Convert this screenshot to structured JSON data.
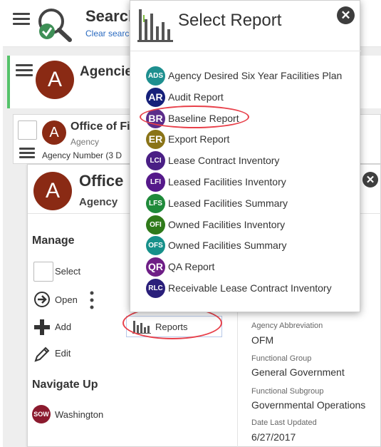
{
  "search": {
    "title": "Search",
    "subtitle": "Clear search"
  },
  "agencies": {
    "title": "Agencies",
    "avatar_letter": "A"
  },
  "office_row": {
    "avatar_letter": "A",
    "title": "Office of Fi",
    "subtitle": "Agency",
    "agency_number_label": "Agency Number (3 D"
  },
  "detail": {
    "avatar_letter": "A",
    "title": "Office",
    "subtitle": "Agency",
    "manage_heading": "Manage",
    "actions": {
      "select": "Select",
      "open": "Open",
      "add": "Add",
      "edit": "Edit"
    },
    "reports_button": "Reports",
    "navigate_heading": "Navigate Up",
    "navigate_item": {
      "badge": "SOW",
      "label": "Washington"
    },
    "fields": [
      {
        "label": "Agency Abbreviation",
        "value": "OFM"
      },
      {
        "label": "Functional Group",
        "value": "General Government"
      },
      {
        "label": "Functional Subgroup",
        "value": "Governmental Operations"
      },
      {
        "label": "Date Last Updated",
        "value": "6/27/2017"
      }
    ]
  },
  "popup": {
    "title": "Select Report",
    "reports": [
      {
        "abbr": "ADS",
        "label": "Agency Desired Six Year Facilities Plan",
        "color": "#1e8f8f"
      },
      {
        "abbr": "AR",
        "label": "Audit Report",
        "color": "#16207a"
      },
      {
        "abbr": "BR",
        "label": "Baseline Report",
        "color": "#5b2d8a"
      },
      {
        "abbr": "ER",
        "label": "Export Report",
        "color": "#8a7418"
      },
      {
        "abbr": "LCI",
        "label": "Lease Contract Inventory",
        "color": "#4a1f85"
      },
      {
        "abbr": "LFI",
        "label": "Leased Facilities Inventory",
        "color": "#55198a"
      },
      {
        "abbr": "LFS",
        "label": "Leased Facilities Summary",
        "color": "#1f8a3a"
      },
      {
        "abbr": "OFI",
        "label": "Owned Facilities Inventory",
        "color": "#2f7a1a"
      },
      {
        "abbr": "OFS",
        "label": "Owned Facilities Summary",
        "color": "#16908a"
      },
      {
        "abbr": "QR",
        "label": "QA Report",
        "color": "#6e1e86"
      },
      {
        "abbr": "RLC",
        "label": "Receivable Lease Contract Inventory",
        "color": "#2a1f7a"
      }
    ]
  },
  "colors": {
    "accent_green": "#55c26a",
    "annotation_red": "#e8404a",
    "avatar": "#8a2a14"
  }
}
